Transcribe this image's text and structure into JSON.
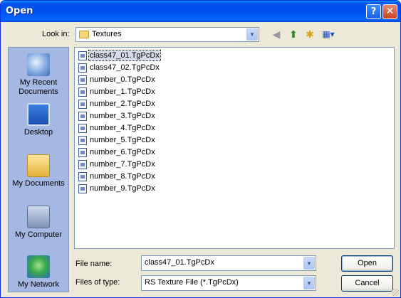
{
  "window": {
    "title": "Open"
  },
  "titlebar": {
    "help_glyph": "?",
    "close_glyph": "✕"
  },
  "toolbar": {
    "look_in_label": "Look in:",
    "look_in_value": "Textures",
    "back_icon": "back-arrow-icon",
    "up_icon": "up-folder-icon",
    "new_folder_icon": "new-folder-icon",
    "views_icon": "views-menu-icon"
  },
  "places": [
    {
      "label": "My Recent Documents",
      "icon": "recent-documents-icon"
    },
    {
      "label": "Desktop",
      "icon": "desktop-icon"
    },
    {
      "label": "My Documents",
      "icon": "my-documents-icon"
    },
    {
      "label": "My Computer",
      "icon": "my-computer-icon"
    },
    {
      "label": "My Network",
      "icon": "my-network-icon"
    }
  ],
  "files": [
    "class47_01.TgPcDx",
    "class47_02.TgPcDx",
    "number_0.TgPcDx",
    "number_1.TgPcDx",
    "number_2.TgPcDx",
    "number_3.TgPcDx",
    "number_4.TgPcDx",
    "number_5.TgPcDx",
    "number_6.TgPcDx",
    "number_7.TgPcDx",
    "number_8.TgPcDx",
    "number_9.TgPcDx"
  ],
  "selected_file": "class47_01.TgPcDx",
  "form": {
    "file_name_label": "File name:",
    "file_name_value": "class47_01.TgPcDx",
    "files_of_type_label": "Files of type:",
    "files_of_type_value": "RS Texture File (*.TgPcDx)"
  },
  "buttons": {
    "open": "Open",
    "cancel": "Cancel"
  },
  "colors": {
    "titlebar": "#0053ee",
    "dialog_bg": "#ece9d8",
    "places_bg": "#a5b8e4"
  }
}
